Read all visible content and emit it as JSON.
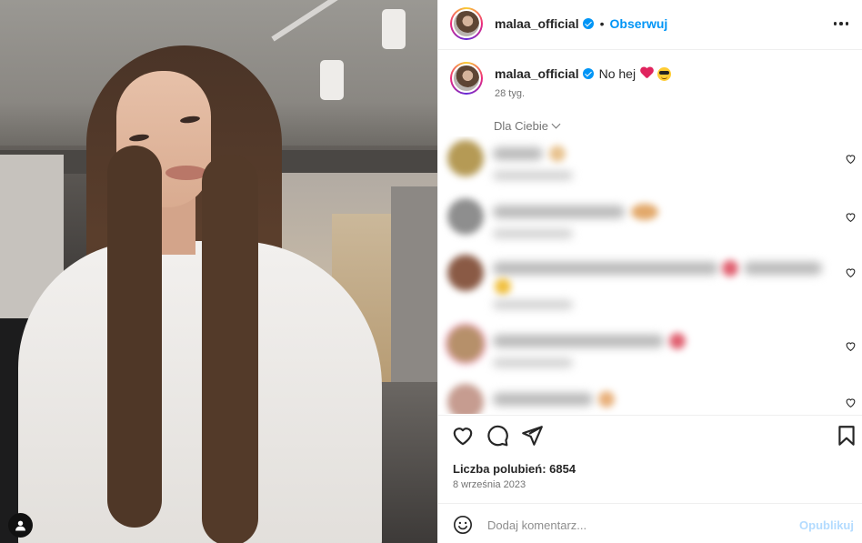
{
  "post": {
    "username": "malaa_official",
    "follow_label": "Obserwuj",
    "separator": "•",
    "caption_text": "No hej",
    "caption_emojis": [
      "red-heart-emoji",
      "sunglasses-emoji"
    ],
    "caption_age": "28 tyg.",
    "comments_filter": "Dla Ciebie",
    "likes_label": "Liczba polubień: 6854",
    "date": "8 września 2023"
  },
  "comment_composer": {
    "placeholder": "Dodaj komentarz...",
    "publish_label": "Opublikuj"
  },
  "comments": {
    "blurred_count": 5
  },
  "icons": {
    "header_more": "more-horizontal-icon",
    "like": "heart-outline-icon",
    "comment": "comment-bubble-icon",
    "share": "paper-plane-icon",
    "save": "bookmark-icon",
    "emoji_picker": "smiley-icon",
    "photo_user_tag": "user-tag-icon"
  },
  "colors": {
    "link_blue": "#0095f6",
    "publish_disabled": "#b3dbff",
    "secondary_text": "#737373",
    "border": "#efefef"
  }
}
